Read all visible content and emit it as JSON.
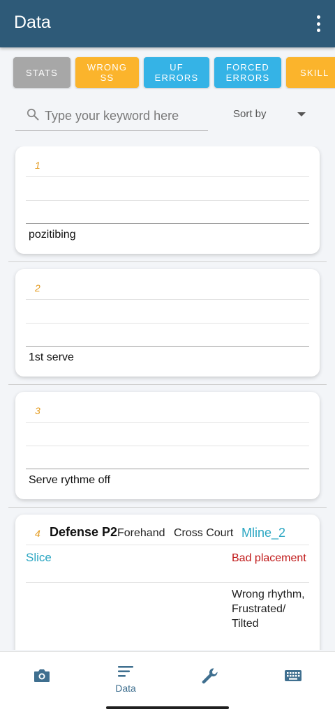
{
  "appbar": {
    "title": "Data",
    "menu_icon": "more-vert-icon"
  },
  "filters": [
    {
      "label": "STATS",
      "color": "#a7a7a7"
    },
    {
      "label": "WRONG\nSS",
      "color": "#fbb42c"
    },
    {
      "label": "UF\nERRORS",
      "color": "#35b3e6"
    },
    {
      "label": "FORCED\nERRORS",
      "color": "#35b3e6"
    },
    {
      "label": "SKILL",
      "color": "#fbb42c"
    }
  ],
  "search": {
    "placeholder": "Type your keyword here",
    "value": ""
  },
  "sort": {
    "label": "Sort by"
  },
  "cards": [
    {
      "number": "1",
      "note": "pozitibing"
    },
    {
      "number": "2",
      "note": "1st serve"
    },
    {
      "number": "3",
      "note": "Serve rythme off"
    }
  ],
  "detail_card": {
    "number": "4",
    "title": "Defense P2",
    "stroke": "Forehand",
    "direction": "Cross Court",
    "line": "Mline_2",
    "shot": "Slice",
    "error": "Bad placement",
    "reason": "Wrong rhythm, Frustrated/ Tilted"
  },
  "nav": [
    {
      "icon": "camera-icon",
      "label": ""
    },
    {
      "icon": "list-icon",
      "label": "Data"
    },
    {
      "icon": "wrench-icon",
      "label": ""
    },
    {
      "icon": "keyboard-icon",
      "label": ""
    }
  ],
  "colors": {
    "appbar": "#2e5a78",
    "accent_orange": "#e39a1e",
    "accent_teal": "#2aa6c2",
    "error_red": "#c01818"
  }
}
